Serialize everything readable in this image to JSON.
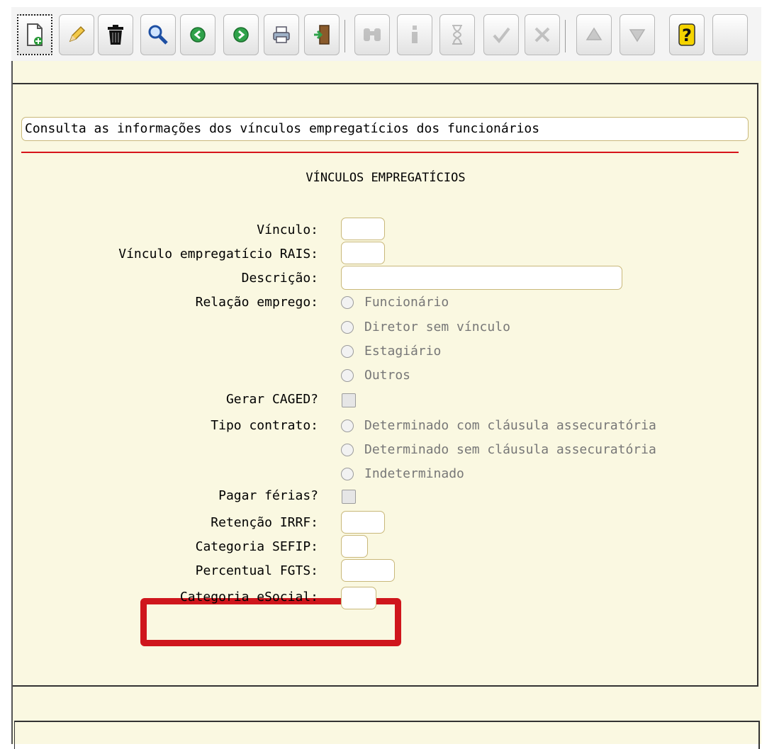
{
  "toolbar": {
    "buttons": [
      {
        "icon": "new-document-icon",
        "state": "focused"
      },
      {
        "icon": "edit-pencil-icon",
        "state": "enabled"
      },
      {
        "icon": "trash-icon",
        "state": "enabled"
      },
      {
        "icon": "search-magnifier-icon",
        "state": "enabled"
      },
      {
        "icon": "previous-arrow-icon",
        "state": "enabled"
      },
      {
        "icon": "next-arrow-icon",
        "state": "enabled"
      },
      {
        "icon": "print-icon",
        "state": "enabled"
      },
      {
        "icon": "exit-door-icon",
        "state": "enabled"
      },
      {
        "icon": "binoculars-icon",
        "state": "disabled"
      },
      {
        "icon": "info-icon",
        "state": "disabled"
      },
      {
        "icon": "hourglass-icon",
        "state": "disabled"
      },
      {
        "icon": "confirm-check-icon",
        "state": "disabled"
      },
      {
        "icon": "cancel-tools-icon",
        "state": "disabled"
      },
      {
        "icon": "first-record-icon",
        "state": "disabled"
      },
      {
        "icon": "last-record-icon",
        "state": "disabled"
      },
      {
        "icon": "help-question-icon",
        "state": "enabled"
      },
      {
        "icon": "blank-button",
        "state": "disabled"
      }
    ]
  },
  "form": {
    "description": "Consulta as informações dos vínculos empregatícios dos funcionários",
    "heading": "VÍNCULOS EMPREGATÍCIOS",
    "labels": {
      "vinculo": "Vínculo:",
      "vinculo_rais": "Vínculo empregatício RAIS:",
      "descricao": "Descrição:",
      "relacao_emprego": "Relação emprego:",
      "gerar_caged": "Gerar CAGED?",
      "tipo_contrato": "Tipo contrato:",
      "pagar_ferias": "Pagar férias?",
      "retencao_irrf": "Retenção IRRF:",
      "categoria_sefip": "Categoria SEFIP:",
      "percentual_fgts": "Percentual FGTS:",
      "categoria_esocial": "Categoria eSocial:"
    },
    "values": {
      "vinculo": "",
      "vinculo_rais": "",
      "descricao": "",
      "retencao_irrf": "",
      "categoria_sefip": "",
      "percentual_fgts": "",
      "categoria_esocial": ""
    },
    "relacao_emprego_options": [
      "Funcionário",
      "Diretor sem vínculo",
      "Estagiário",
      "Outros"
    ],
    "tipo_contrato_options": [
      "Determinado com cláusula assecuratória",
      "Determinado sem cláusula assecuratória",
      "Indeterminado"
    ],
    "gerar_caged_checked": false,
    "pagar_ferias_checked": false
  },
  "colors": {
    "form_background": "#faf8e1",
    "field_border": "#c9b87a",
    "highlight": "#cf161c",
    "rule": "#d6141b"
  }
}
